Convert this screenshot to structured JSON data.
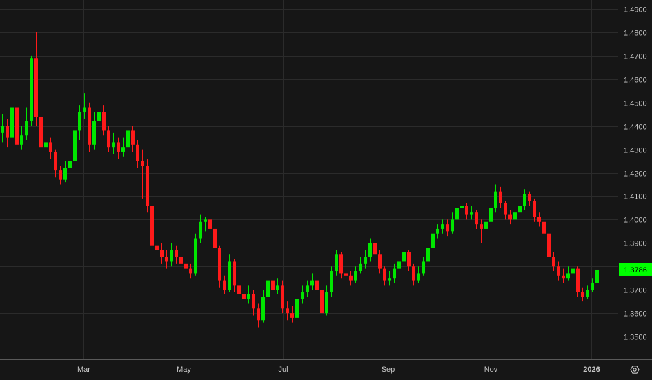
{
  "chart_data": {
    "type": "candlestick",
    "title": "",
    "xlabel": "",
    "ylabel": "",
    "ylim": [
      1.3445,
      1.494
    ],
    "grid": true,
    "x_tick_labels": [
      "Mar",
      "May",
      "Jul",
      "Sep",
      "Nov",
      "2026"
    ],
    "y_tick_labels": [
      "1.3500",
      "1.3600",
      "1.3700",
      "1.3800",
      "1.3900",
      "1.4000",
      "1.4100",
      "1.4200",
      "1.4300",
      "1.4400",
      "1.4500",
      "1.4600",
      "1.4700",
      "1.4800",
      "1.4900"
    ],
    "y_tick_values": [
      1.35,
      1.36,
      1.37,
      1.38,
      1.39,
      1.4,
      1.41,
      1.42,
      1.43,
      1.44,
      1.45,
      1.46,
      1.47,
      1.48,
      1.49
    ],
    "last_price": 1.3786,
    "last_price_label": "1.3786",
    "colors": {
      "up": "#00e600",
      "down": "#ff1a1a",
      "last_price_bg": "#00ff00",
      "background": "#161616",
      "grid": "#2b2b2b"
    },
    "candle_format": [
      "open",
      "high",
      "low",
      "close"
    ],
    "candles": [
      [
        1.437,
        1.445,
        1.433,
        1.44
      ],
      [
        1.44,
        1.443,
        1.431,
        1.435
      ],
      [
        1.435,
        1.45,
        1.433,
        1.448
      ],
      [
        1.448,
        1.449,
        1.429,
        1.432
      ],
      [
        1.432,
        1.44,
        1.43,
        1.436
      ],
      [
        1.436,
        1.448,
        1.434,
        1.442
      ],
      [
        1.442,
        1.47,
        1.44,
        1.469
      ],
      [
        1.469,
        1.48,
        1.44,
        1.444
      ],
      [
        1.444,
        1.446,
        1.429,
        1.431
      ],
      [
        1.431,
        1.436,
        1.428,
        1.433
      ],
      [
        1.433,
        1.435,
        1.426,
        1.429
      ],
      [
        1.429,
        1.43,
        1.418,
        1.421
      ],
      [
        1.421,
        1.423,
        1.415,
        1.417
      ],
      [
        1.417,
        1.425,
        1.416,
        1.422
      ],
      [
        1.422,
        1.428,
        1.419,
        1.425
      ],
      [
        1.425,
        1.44,
        1.423,
        1.438
      ],
      [
        1.438,
        1.449,
        1.434,
        1.446
      ],
      [
        1.446,
        1.454,
        1.443,
        1.448
      ],
      [
        1.448,
        1.45,
        1.429,
        1.432
      ],
      [
        1.432,
        1.446,
        1.43,
        1.442
      ],
      [
        1.442,
        1.452,
        1.439,
        1.446
      ],
      [
        1.446,
        1.449,
        1.436,
        1.438
      ],
      [
        1.438,
        1.44,
        1.429,
        1.431
      ],
      [
        1.431,
        1.437,
        1.428,
        1.433
      ],
      [
        1.433,
        1.435,
        1.426,
        1.429
      ],
      [
        1.429,
        1.435,
        1.427,
        1.431
      ],
      [
        1.431,
        1.441,
        1.429,
        1.438
      ],
      [
        1.438,
        1.44,
        1.429,
        1.432
      ],
      [
        1.432,
        1.434,
        1.422,
        1.425
      ],
      [
        1.425,
        1.43,
        1.409,
        1.423
      ],
      [
        1.423,
        1.426,
        1.403,
        1.406
      ],
      [
        1.406,
        1.408,
        1.386,
        1.389
      ],
      [
        1.389,
        1.392,
        1.384,
        1.387
      ],
      [
        1.387,
        1.39,
        1.381,
        1.384
      ],
      [
        1.384,
        1.387,
        1.379,
        1.382
      ],
      [
        1.382,
        1.39,
        1.38,
        1.387
      ],
      [
        1.387,
        1.389,
        1.381,
        1.384
      ],
      [
        1.384,
        1.386,
        1.378,
        1.381
      ],
      [
        1.381,
        1.384,
        1.376,
        1.379
      ],
      [
        1.379,
        1.381,
        1.375,
        1.377
      ],
      [
        1.377,
        1.394,
        1.376,
        1.392
      ],
      [
        1.392,
        1.402,
        1.39,
        1.399
      ],
      [
        1.399,
        1.401,
        1.395,
        1.4
      ],
      [
        1.4,
        1.401,
        1.393,
        1.396
      ],
      [
        1.396,
        1.397,
        1.385,
        1.388
      ],
      [
        1.388,
        1.389,
        1.371,
        1.374
      ],
      [
        1.374,
        1.376,
        1.368,
        1.37
      ],
      [
        1.37,
        1.385,
        1.369,
        1.382
      ],
      [
        1.382,
        1.383,
        1.369,
        1.372
      ],
      [
        1.372,
        1.374,
        1.365,
        1.368
      ],
      [
        1.368,
        1.37,
        1.363,
        1.366
      ],
      [
        1.366,
        1.372,
        1.364,
        1.368
      ],
      [
        1.368,
        1.37,
        1.359,
        1.362
      ],
      [
        1.362,
        1.364,
        1.354,
        1.357
      ],
      [
        1.357,
        1.37,
        1.356,
        1.367
      ],
      [
        1.367,
        1.376,
        1.365,
        1.374
      ],
      [
        1.374,
        1.376,
        1.367,
        1.37
      ],
      [
        1.37,
        1.375,
        1.368,
        1.372
      ],
      [
        1.372,
        1.374,
        1.36,
        1.362
      ],
      [
        1.362,
        1.365,
        1.357,
        1.36
      ],
      [
        1.36,
        1.363,
        1.356,
        1.358
      ],
      [
        1.358,
        1.369,
        1.357,
        1.366
      ],
      [
        1.366,
        1.372,
        1.364,
        1.369
      ],
      [
        1.369,
        1.374,
        1.367,
        1.372
      ],
      [
        1.372,
        1.377,
        1.37,
        1.374
      ],
      [
        1.374,
        1.376,
        1.368,
        1.37
      ],
      [
        1.37,
        1.371,
        1.358,
        1.36
      ],
      [
        1.36,
        1.372,
        1.359,
        1.369
      ],
      [
        1.369,
        1.38,
        1.367,
        1.378
      ],
      [
        1.378,
        1.387,
        1.376,
        1.385
      ],
      [
        1.385,
        1.386,
        1.375,
        1.377
      ],
      [
        1.377,
        1.38,
        1.374,
        1.376
      ],
      [
        1.376,
        1.378,
        1.372,
        1.374
      ],
      [
        1.374,
        1.38,
        1.373,
        1.378
      ],
      [
        1.378,
        1.384,
        1.377,
        1.381
      ],
      [
        1.381,
        1.387,
        1.379,
        1.384
      ],
      [
        1.384,
        1.392,
        1.382,
        1.39
      ],
      [
        1.39,
        1.391,
        1.383,
        1.385
      ],
      [
        1.385,
        1.387,
        1.377,
        1.379
      ],
      [
        1.379,
        1.38,
        1.372,
        1.374
      ],
      [
        1.374,
        1.378,
        1.372,
        1.375
      ],
      [
        1.375,
        1.381,
        1.373,
        1.379
      ],
      [
        1.379,
        1.385,
        1.377,
        1.382
      ],
      [
        1.382,
        1.389,
        1.38,
        1.386
      ],
      [
        1.386,
        1.387,
        1.378,
        1.38
      ],
      [
        1.38,
        1.381,
        1.372,
        1.374
      ],
      [
        1.374,
        1.38,
        1.373,
        1.377
      ],
      [
        1.377,
        1.384,
        1.376,
        1.382
      ],
      [
        1.382,
        1.391,
        1.38,
        1.388
      ],
      [
        1.388,
        1.396,
        1.386,
        1.394
      ],
      [
        1.394,
        1.398,
        1.392,
        1.396
      ],
      [
        1.396,
        1.4,
        1.394,
        1.398
      ],
      [
        1.398,
        1.4,
        1.393,
        1.395
      ],
      [
        1.395,
        1.403,
        1.394,
        1.4
      ],
      [
        1.4,
        1.407,
        1.398,
        1.405
      ],
      [
        1.405,
        1.408,
        1.403,
        1.406
      ],
      [
        1.406,
        1.407,
        1.4,
        1.402
      ],
      [
        1.402,
        1.406,
        1.4,
        1.403
      ],
      [
        1.403,
        1.404,
        1.396,
        1.398
      ],
      [
        1.398,
        1.4,
        1.39,
        1.396
      ],
      [
        1.396,
        1.402,
        1.394,
        1.399
      ],
      [
        1.399,
        1.408,
        1.397,
        1.405
      ],
      [
        1.405,
        1.415,
        1.403,
        1.412
      ],
      [
        1.412,
        1.414,
        1.405,
        1.407
      ],
      [
        1.407,
        1.408,
        1.4,
        1.402
      ],
      [
        1.402,
        1.404,
        1.398,
        1.4
      ],
      [
        1.4,
        1.406,
        1.398,
        1.403
      ],
      [
        1.403,
        1.409,
        1.401,
        1.406
      ],
      [
        1.406,
        1.413,
        1.404,
        1.411
      ],
      [
        1.411,
        1.412,
        1.406,
        1.408
      ],
      [
        1.408,
        1.409,
        1.399,
        1.401
      ],
      [
        1.401,
        1.403,
        1.397,
        1.399
      ],
      [
        1.399,
        1.4,
        1.392,
        1.394
      ],
      [
        1.394,
        1.395,
        1.382,
        1.384
      ],
      [
        1.384,
        1.386,
        1.378,
        1.38
      ],
      [
        1.38,
        1.382,
        1.374,
        1.376
      ],
      [
        1.376,
        1.379,
        1.373,
        1.375
      ],
      [
        1.375,
        1.38,
        1.374,
        1.377
      ],
      [
        1.377,
        1.381,
        1.375,
        1.379
      ],
      [
        1.379,
        1.38,
        1.367,
        1.369
      ],
      [
        1.369,
        1.371,
        1.365,
        1.367
      ],
      [
        1.367,
        1.372,
        1.366,
        1.37
      ],
      [
        1.37,
        1.375,
        1.369,
        1.373
      ],
      [
        1.373,
        1.3815,
        1.372,
        1.3786
      ]
    ]
  }
}
